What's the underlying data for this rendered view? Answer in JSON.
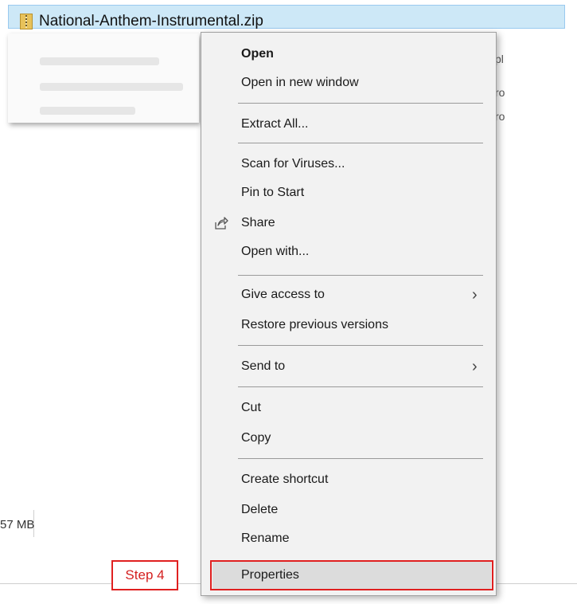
{
  "file": {
    "name": "National-Anthem-Instrumental.zip",
    "icon": "zip-folder-icon"
  },
  "right_strip": [
    "pl",
    "ro",
    "ro"
  ],
  "size_text": "57 MB",
  "menu": {
    "items": [
      {
        "label": "Open",
        "bold": true
      },
      {
        "label": "Open in new window"
      },
      {
        "label": "Extract All..."
      },
      {
        "label": "Scan for Viruses..."
      },
      {
        "label": "Pin to Start"
      },
      {
        "label": "Share",
        "icon": "share-icon"
      },
      {
        "label": "Open with..."
      },
      {
        "label": "Give access to",
        "submenu": true
      },
      {
        "label": "Restore previous versions"
      },
      {
        "label": "Send to",
        "submenu": true
      },
      {
        "label": "Cut"
      },
      {
        "label": "Copy"
      },
      {
        "label": "Create shortcut"
      },
      {
        "label": "Delete"
      },
      {
        "label": "Rename"
      },
      {
        "label": "Properties",
        "highlighted": true
      }
    ]
  },
  "annotation": {
    "step_label": "Step 4",
    "color": "#e02020"
  }
}
